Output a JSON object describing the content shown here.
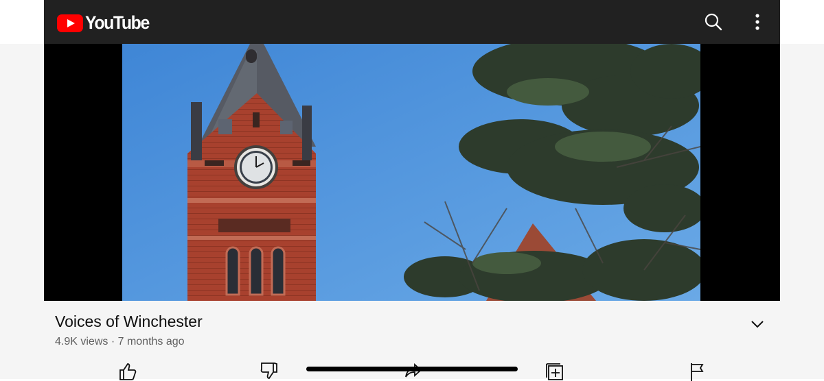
{
  "app": {
    "name": "YouTube"
  },
  "header": {
    "logo_text": "YouTube",
    "icons": [
      "search-icon",
      "more-vertical-icon"
    ]
  },
  "video": {
    "title": "Voices of Winchester",
    "views": "4.9K views",
    "separator": "·",
    "age": "7 months ago"
  },
  "actions": [
    "like-icon",
    "dislike-icon",
    "share-icon",
    "save-to-playlist-icon",
    "report-icon"
  ],
  "colors": {
    "header": "#212121",
    "brand": "#ff0000",
    "sky": "#4d8fd6",
    "brick": "#a8412e"
  }
}
